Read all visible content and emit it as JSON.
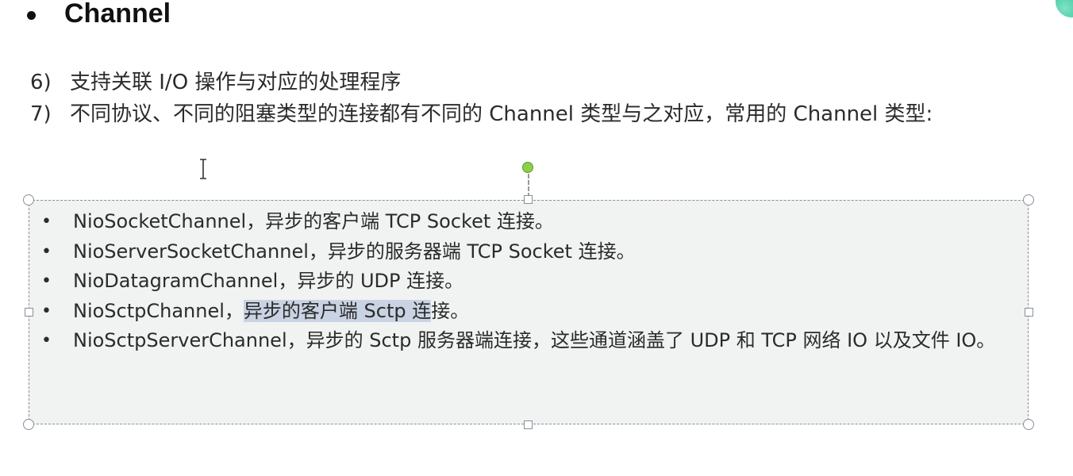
{
  "heading": {
    "title": "Channel"
  },
  "numbered_items": [
    {
      "num": "6)",
      "text": "支持关联 I/O 操作与对应的处理程序"
    },
    {
      "num": "7)",
      "text": "不同协议、不同的阻塞类型的连接都有不同的 Channel 类型与之对应，常用的 Channel 类型:"
    }
  ],
  "bullets": [
    {
      "dot": "•",
      "text": "NioSocketChannel，异步的客户端 TCP Socket 连接。"
    },
    {
      "dot": "•",
      "text": "NioServerSocketChannel，异步的服务器端 TCP Socket 连接。"
    },
    {
      "dot": "•",
      "text": "NioDatagramChannel，异步的 UDP 连接。"
    },
    {
      "dot": "•",
      "before": "NioSctpChannel，",
      "selected": "异步的客户端 Sctp 连",
      "after": "接。"
    },
    {
      "dot": "•",
      "text": "NioSctpServerChannel，异步的 Sctp 服务器端连接，这些通道涵盖了 UDP 和 TCP 网络 IO 以及文件 IO。"
    }
  ],
  "colors": {
    "selection_highlight": "#c9d3e3",
    "text_box_fill": "#f1f2f2",
    "rotate_handle": "#8cd04a"
  },
  "icons": {
    "heading_bullet": "filled-circle",
    "cursor": "i-beam-cursor-icon"
  }
}
